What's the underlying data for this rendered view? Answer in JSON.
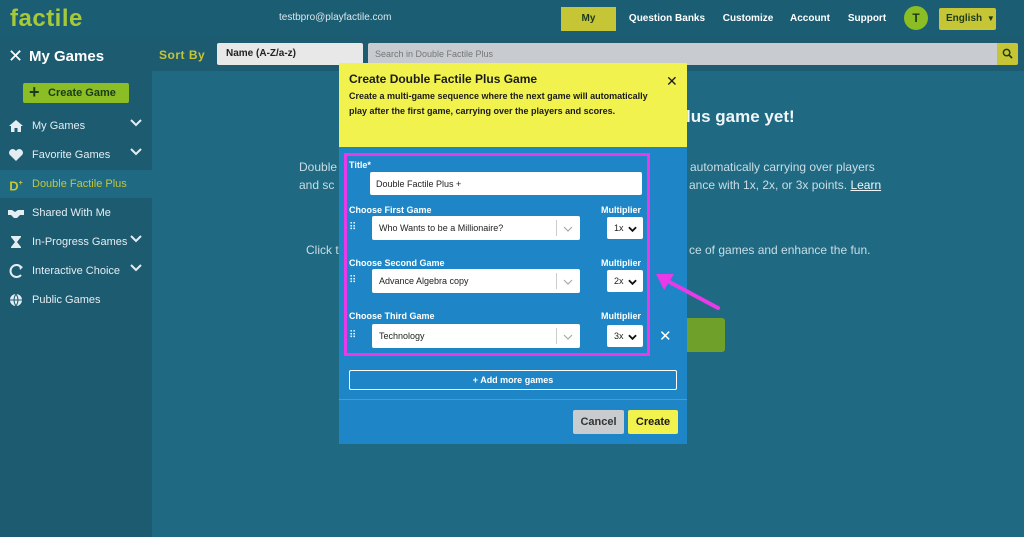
{
  "header": {
    "logo": "factile",
    "email": "testbpro@playfactile.com",
    "nav": [
      "My Games",
      "Question Banks",
      "Customize",
      "Account",
      "Support"
    ],
    "avatar_initial": "T",
    "language": "English"
  },
  "sidebar": {
    "title": "My Games",
    "create_button": "Create Game",
    "items": [
      {
        "label": "My Games",
        "icon": "home-icon"
      },
      {
        "label": "Favorite Games",
        "icon": "heart-icon"
      },
      {
        "label": "Double Factile Plus",
        "icon": "double-factile-icon"
      },
      {
        "label": "Shared With Me",
        "icon": "handshake-icon"
      },
      {
        "label": "In-Progress Games",
        "icon": "hourglass-icon"
      },
      {
        "label": "Interactive Choice",
        "icon": "interactive-icon"
      },
      {
        "label": "Public Games",
        "icon": "globe-icon"
      }
    ]
  },
  "toolbar": {
    "sort_label": "Sort By",
    "sort_value": "Name (A-Z/a-z)",
    "search_placeholder": "Search in Double Factile Plus"
  },
  "background": {
    "heading_fragment": "lus game yet!",
    "line1_left": "Double",
    "line1_right": "automatically carrying over players",
    "line2_left": "and sc",
    "line2_right": "ance with 1x, 2x, or 3x points.",
    "line2_link": "Learn",
    "line3_left": "Click t",
    "line3_right": "ce of games and enhance the fun."
  },
  "modal": {
    "title": "Create Double Factile Plus Game",
    "description": "Create a multi-game sequence where the next game will automatically play after the first game, carrying over the players and scores.",
    "title_label": "Title*",
    "title_value": "Double Factile Plus +",
    "multiplier_label": "Multiplier",
    "games": [
      {
        "label": "Choose  First Game",
        "value": "Who Wants to be a Millionaire?",
        "multiplier": "1x"
      },
      {
        "label": "Choose  Second Game",
        "value": "Advance Algebra copy",
        "multiplier": "2x"
      },
      {
        "label": "Choose  Third Game",
        "value": "Technology",
        "multiplier": "3x"
      }
    ],
    "add_more": "+ Add more games",
    "cancel": "Cancel",
    "create": "Create"
  },
  "colors": {
    "accent_yellow": "#f1f24d",
    "brand_green": "#8bbd24",
    "modal_blue": "#1e86c6",
    "highlight_magenta": "#e83ae8"
  }
}
